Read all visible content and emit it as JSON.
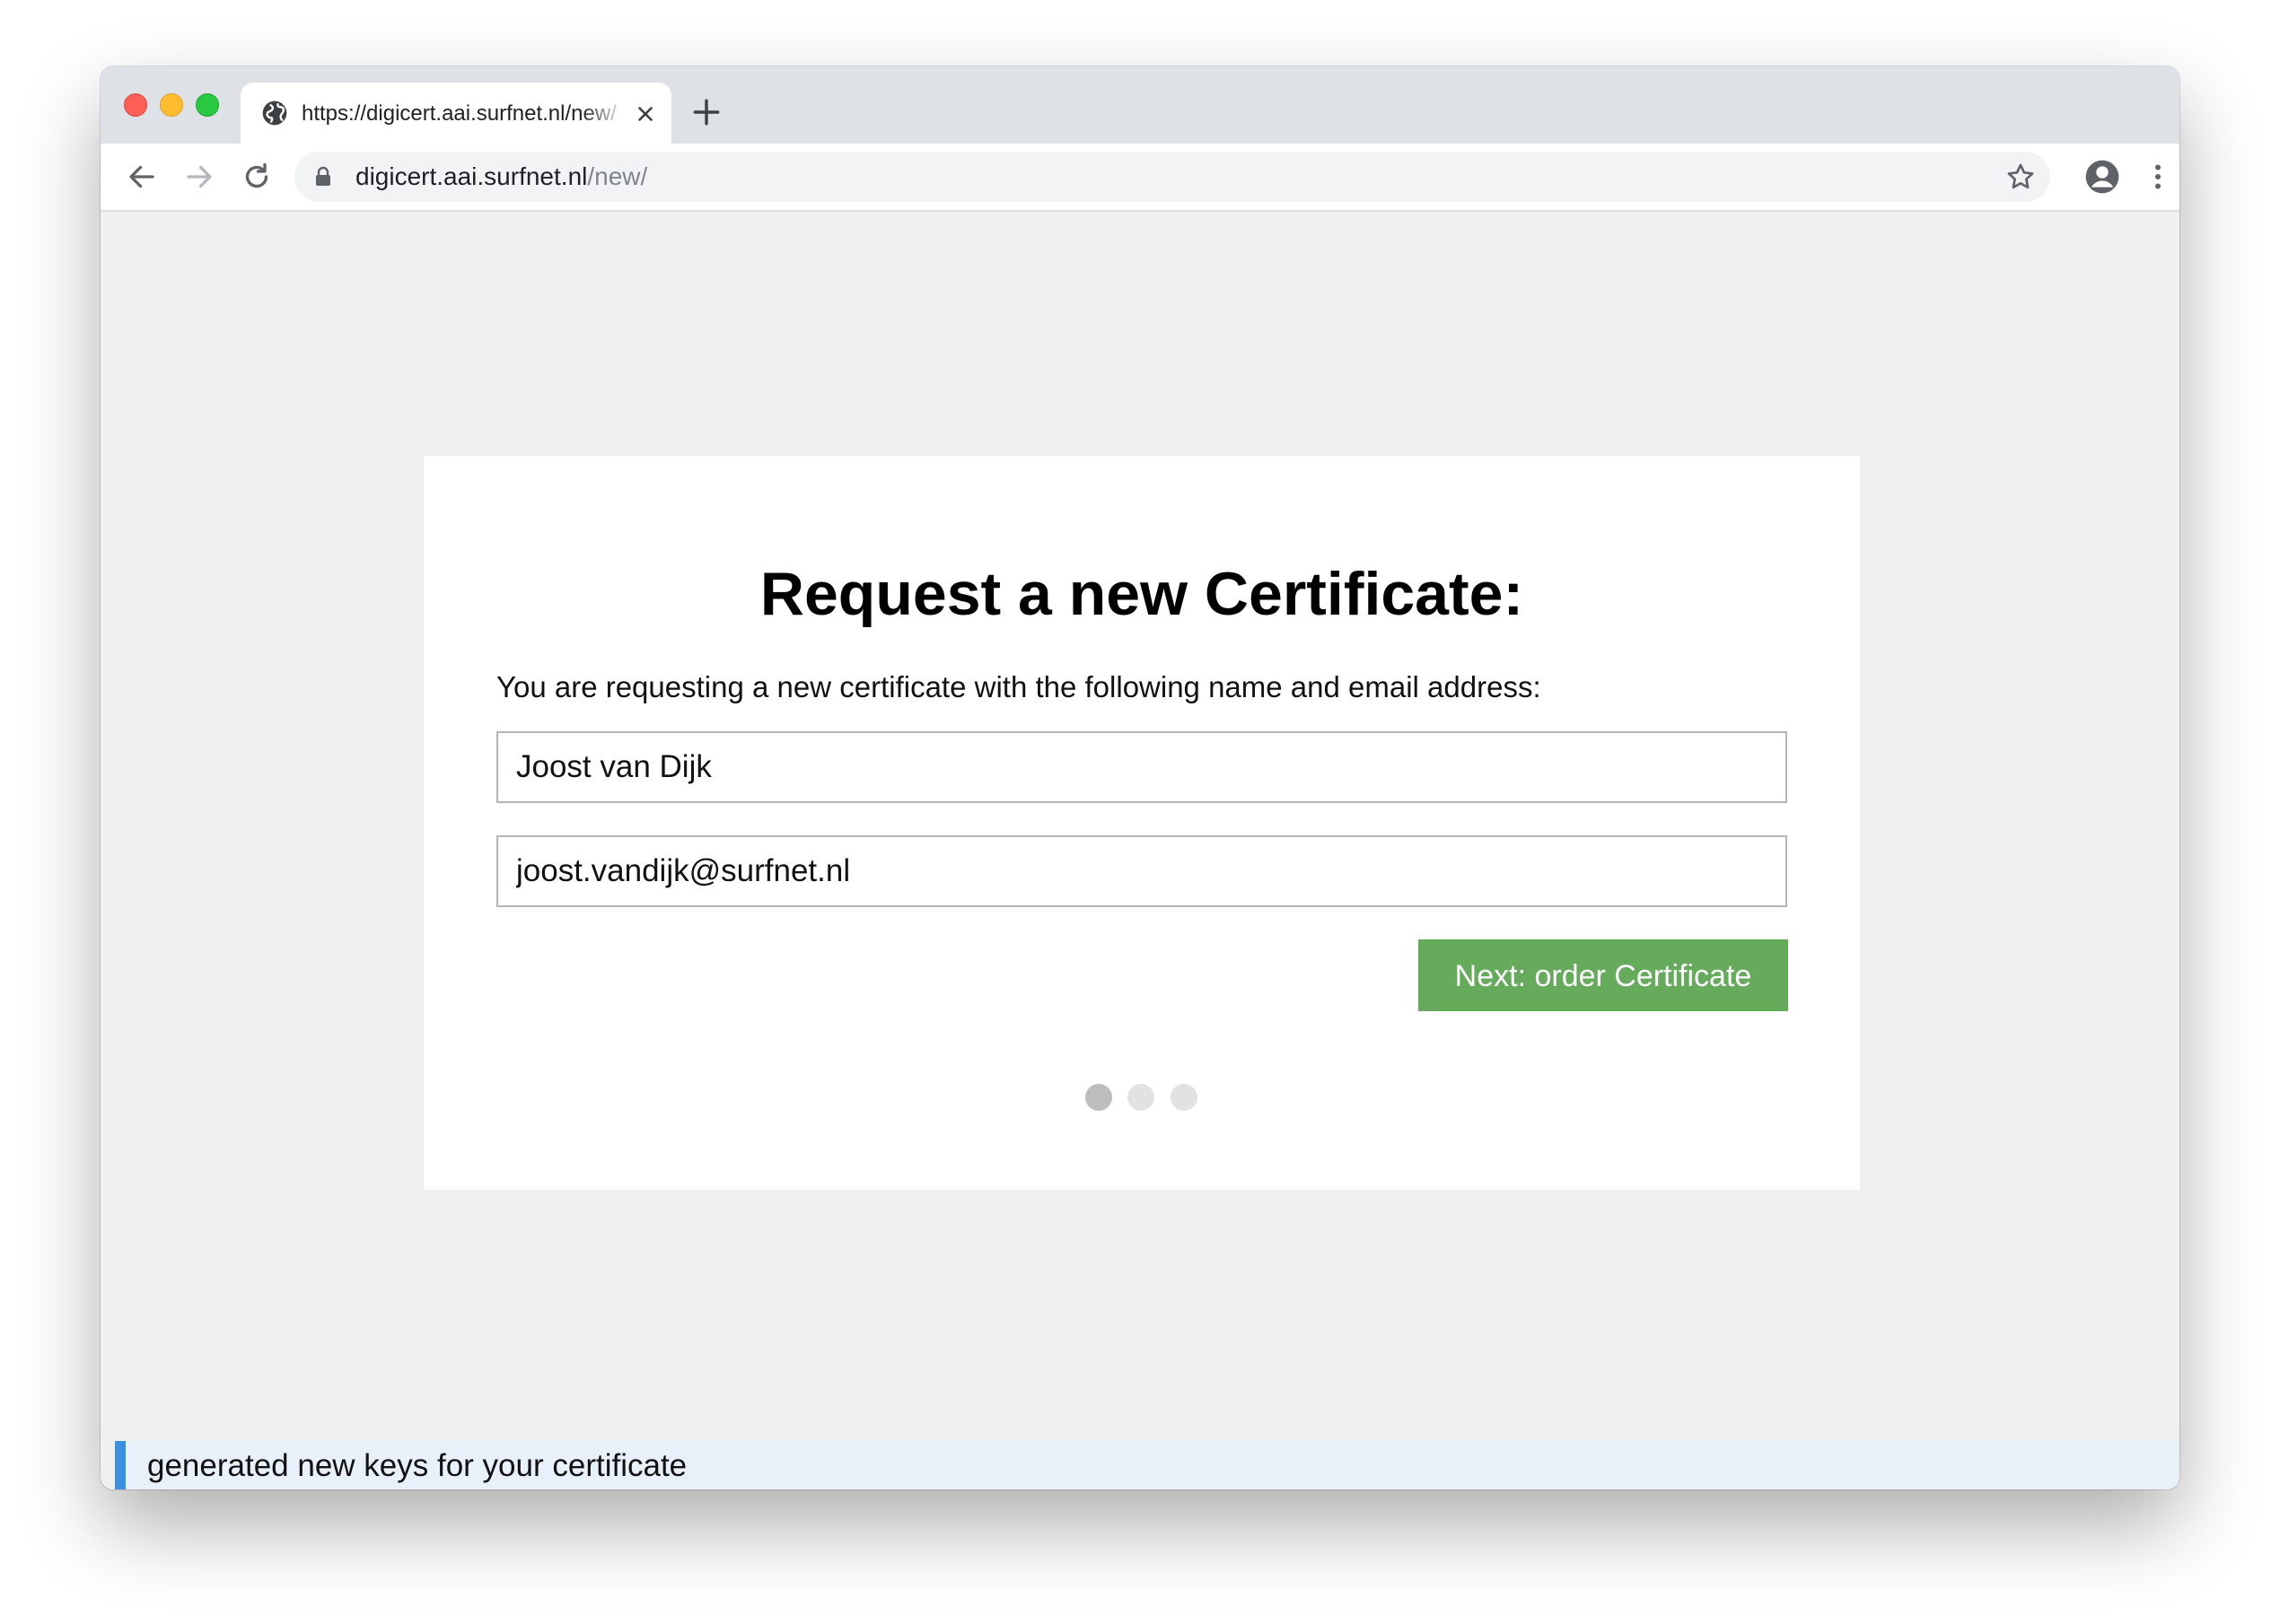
{
  "browser": {
    "tab": {
      "title": "https://digicert.aai.surfnet.nl/new/",
      "icon": "globe-icon"
    },
    "address_bar": {
      "host": "digicert.aai.surfnet.nl",
      "path": "/new/",
      "icon": "lock-icon"
    },
    "toolbar_icons": [
      "back-arrow-icon",
      "forward-arrow-icon",
      "reload-icon",
      "bookmark-star-icon",
      "profile-icon",
      "menu-icon"
    ]
  },
  "form": {
    "heading": "Request a new Certificate:",
    "intro": "You are requesting a new certificate with the following name and email address:",
    "name_value": "Joost van Dijk",
    "email_value": "joost.vandijk@surfnet.nl",
    "next_label": "Next: order Certificate",
    "next_color": "#66aa5c",
    "steps": {
      "total": 3,
      "current": 1,
      "active_color": "#bdbdbd",
      "inactive_color": "#e2e2e2"
    }
  },
  "status": {
    "message": "generated new keys for your certificate",
    "accent_color": "#3d8fe0"
  }
}
